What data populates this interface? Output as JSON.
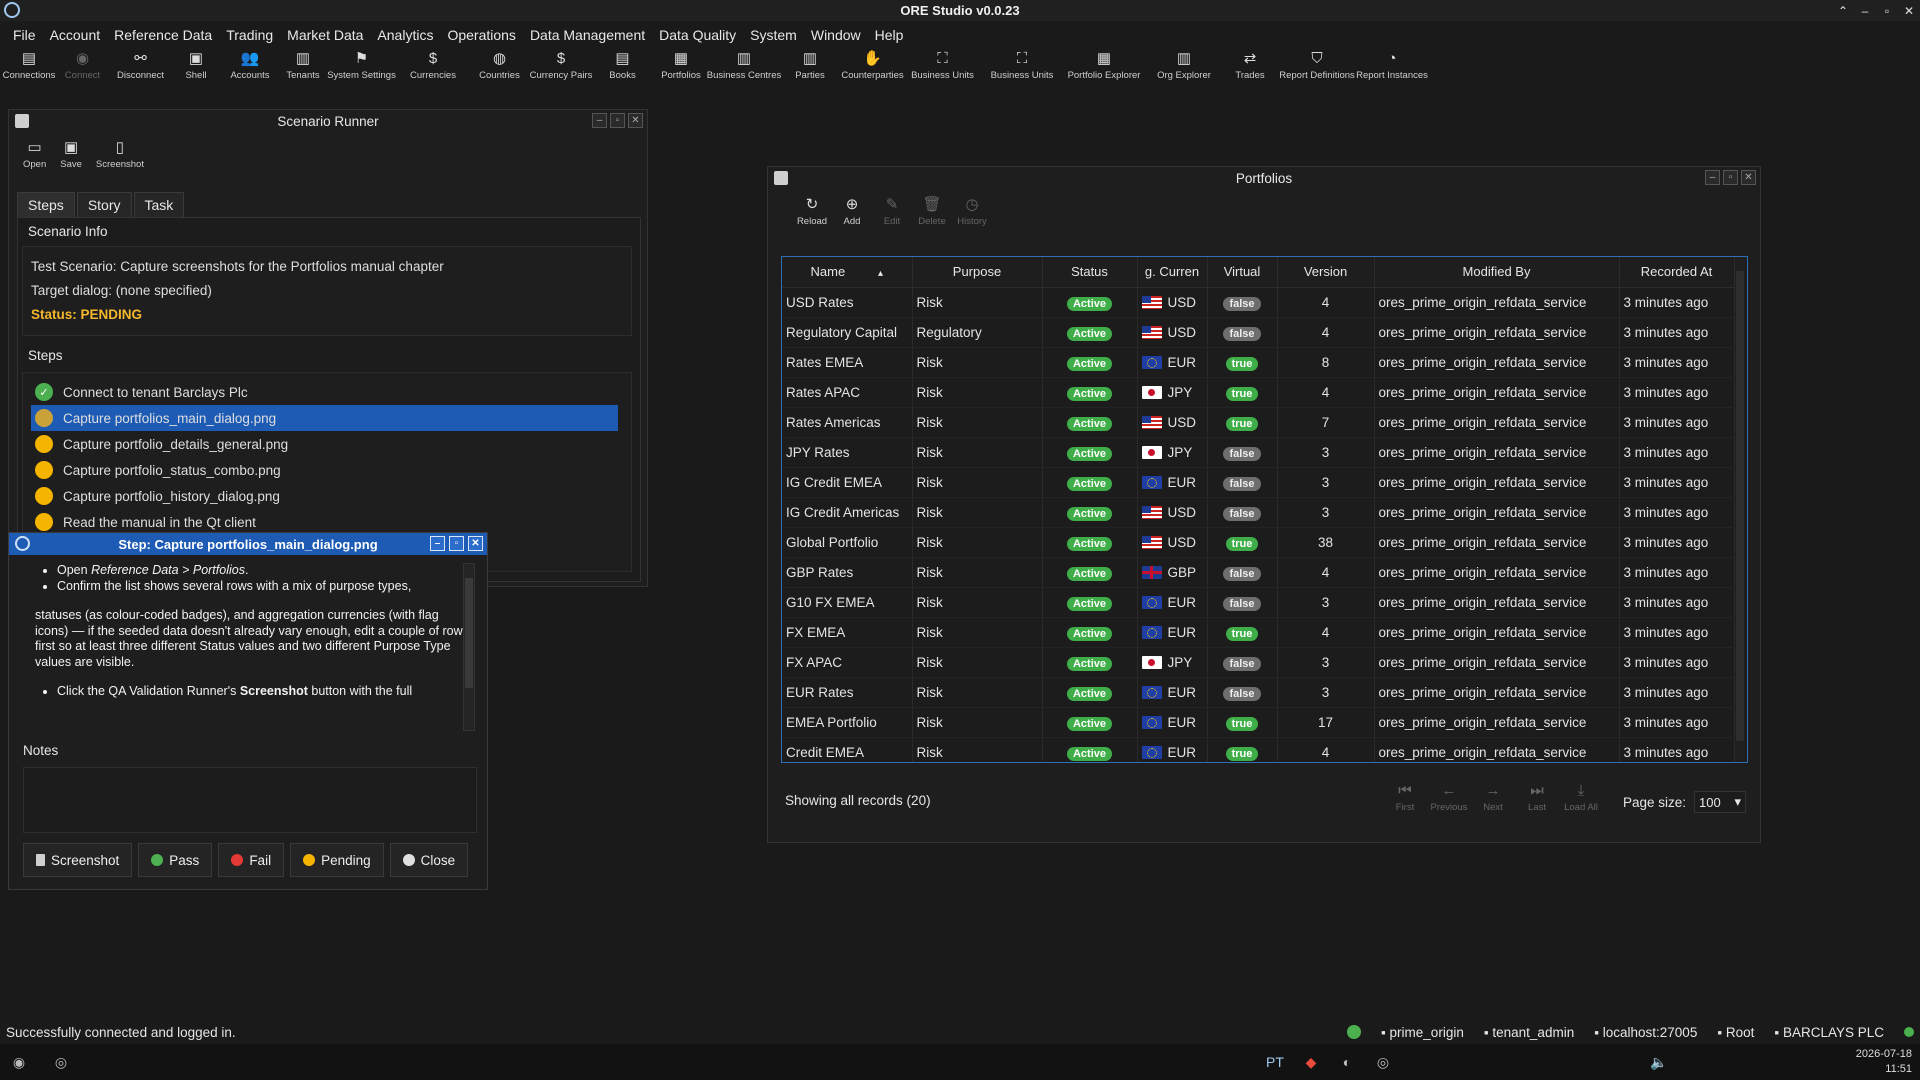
{
  "app": {
    "title": "ORE Studio v0.0.23"
  },
  "menu": [
    "File",
    "Account",
    "Reference Data",
    "Trading",
    "Market Data",
    "Analytics",
    "Operations",
    "Data Management",
    "Data Quality",
    "System",
    "Window",
    "Help"
  ],
  "toolbar": [
    {
      "label": "Connections",
      "icon": "connections-icon",
      "glyph": "▤",
      "enabled": true
    },
    {
      "label": "Connect",
      "icon": "connect-icon",
      "glyph": "◉",
      "enabled": false
    },
    {
      "label": "Disconnect",
      "icon": "disconnect-icon",
      "glyph": "⚯",
      "enabled": true
    },
    {
      "label": "Shell",
      "icon": "shell-icon",
      "glyph": "▣",
      "enabled": true
    },
    {
      "label": "Accounts",
      "icon": "accounts-icon",
      "glyph": "👥",
      "enabled": true
    },
    {
      "label": "Tenants",
      "icon": "tenants-icon",
      "glyph": "▥",
      "enabled": true
    },
    {
      "label": "System Settings",
      "icon": "flag-icon",
      "glyph": "⚑",
      "enabled": true
    },
    {
      "label": "Currencies",
      "icon": "currency-icon",
      "glyph": "$",
      "enabled": true
    },
    {
      "label": "Countries",
      "icon": "globe-icon",
      "glyph": "◍",
      "enabled": true
    },
    {
      "label": "Currency Pairs",
      "icon": "currency-pairs-icon",
      "glyph": "$",
      "enabled": true
    },
    {
      "label": "Books",
      "icon": "books-icon",
      "glyph": "▤",
      "enabled": true
    },
    {
      "label": "Portfolios",
      "icon": "briefcase-icon",
      "glyph": "▦",
      "enabled": true
    },
    {
      "label": "Business Centres",
      "icon": "building-icon",
      "glyph": "▥",
      "enabled": true
    },
    {
      "label": "Parties",
      "icon": "parties-icon",
      "glyph": "▥",
      "enabled": true
    },
    {
      "label": "Counterparties",
      "icon": "handshake-icon",
      "glyph": "✋",
      "enabled": true
    },
    {
      "label": "Business Units",
      "icon": "org-icon",
      "glyph": "⛶",
      "enabled": true
    },
    {
      "label": "Business Units",
      "icon": "org-icon",
      "glyph": "⛶",
      "enabled": true
    },
    {
      "label": "Portfolio Explorer",
      "icon": "portfolio-explorer-icon",
      "glyph": "▦",
      "enabled": true
    },
    {
      "label": "Org Explorer",
      "icon": "org-explorer-icon",
      "glyph": "▥",
      "enabled": true
    },
    {
      "label": "Trades",
      "icon": "trades-icon",
      "glyph": "⇄",
      "enabled": true
    },
    {
      "label": "Report Definitions",
      "icon": "report-definitions-icon",
      "glyph": "⛉",
      "enabled": true
    },
    {
      "label": "Report Instances",
      "icon": "report-instances-icon",
      "glyph": "◔",
      "enabled": true
    }
  ],
  "scenario": {
    "title": "Scenario Runner",
    "toolbar": [
      {
        "label": "Open",
        "icon": "open-folder-icon",
        "glyph": "▭"
      },
      {
        "label": "Save",
        "icon": "save-icon",
        "glyph": "▣"
      },
      {
        "label": "Screenshot",
        "icon": "screenshot-icon",
        "glyph": "▯"
      }
    ],
    "tabs": [
      "Steps",
      "Story",
      "Task"
    ],
    "info_label": "Scenario Info",
    "info": {
      "test_scenario": "Test Scenario: Capture screenshots for the Portfolios manual chapter",
      "target_dialog": "Target dialog: (none specified)",
      "status": "Status: PENDING"
    },
    "steps_label": "Steps",
    "steps": [
      {
        "label": "Connect to tenant Barclays Plc",
        "state": "done"
      },
      {
        "label": "Capture portfolios_main_dialog.png",
        "state": "current"
      },
      {
        "label": "Capture portfolio_details_general.png",
        "state": "pending"
      },
      {
        "label": "Capture portfolio_status_combo.png",
        "state": "pending"
      },
      {
        "label": "Capture portfolio_history_dialog.png",
        "state": "pending"
      },
      {
        "label": "Read the manual in the Qt client",
        "state": "pending"
      }
    ]
  },
  "step_dialog": {
    "title": "Step: Capture portfolios_main_dialog.png",
    "open_prefix": "Open ",
    "open_path": "Reference Data > Portfolios",
    "open_suffix": ".",
    "confirm": "Confirm the list shows several rows with a mix of purpose types,",
    "paragraph": "statuses (as colour-coded badges), and aggregation currencies (with flag icons) — if the seeded data doesn't already vary enough, edit a couple of rows first so at least three different Status values and two different Purpose Type values are visible.",
    "click_prefix": "Click the QA Validation Runner's ",
    "click_bold": "Screenshot",
    "click_suffix": " button with the full",
    "notes_label": "Notes",
    "buttons": [
      {
        "label": "Screenshot",
        "icon": "screenshot-icon",
        "color": "#cfcfcf"
      },
      {
        "label": "Pass",
        "icon": "pass-icon",
        "color": "#4caf50"
      },
      {
        "label": "Fail",
        "icon": "fail-icon",
        "color": "#e53935"
      },
      {
        "label": "Pending",
        "icon": "pending-icon",
        "color": "#f5b400"
      },
      {
        "label": "Close",
        "icon": "close-icon",
        "color": "#e0e0e0"
      }
    ]
  },
  "portfolios": {
    "title": "Portfolios",
    "toolbar": [
      {
        "label": "Reload",
        "icon": "reload-icon",
        "glyph": "↻",
        "enabled": true
      },
      {
        "label": "Add",
        "icon": "add-icon",
        "glyph": "⊕",
        "enabled": true
      },
      {
        "label": "Edit",
        "icon": "edit-icon",
        "glyph": "✎",
        "enabled": false
      },
      {
        "label": "Delete",
        "icon": "delete-icon",
        "glyph": "🗑",
        "enabled": false
      },
      {
        "label": "History",
        "icon": "history-icon",
        "glyph": "◷",
        "enabled": false
      }
    ],
    "columns": [
      "Name",
      "Purpose",
      "Status",
      "g. Curren",
      "Virtual",
      "Version",
      "Modified By",
      "Recorded At"
    ],
    "rows": [
      {
        "name": "USD Rates",
        "purpose": "Risk",
        "status": "Active",
        "ccy": "USD",
        "virtual": "false",
        "version": "4",
        "modified_by": "ores_prime_origin_refdata_service",
        "recorded_at": "3 minutes ago"
      },
      {
        "name": "Regulatory Capital",
        "purpose": "Regulatory",
        "status": "Active",
        "ccy": "USD",
        "virtual": "false",
        "version": "4",
        "modified_by": "ores_prime_origin_refdata_service",
        "recorded_at": "3 minutes ago"
      },
      {
        "name": "Rates EMEA",
        "purpose": "Risk",
        "status": "Active",
        "ccy": "EUR",
        "virtual": "true",
        "version": "8",
        "modified_by": "ores_prime_origin_refdata_service",
        "recorded_at": "3 minutes ago"
      },
      {
        "name": "Rates APAC",
        "purpose": "Risk",
        "status": "Active",
        "ccy": "JPY",
        "virtual": "true",
        "version": "4",
        "modified_by": "ores_prime_origin_refdata_service",
        "recorded_at": "3 minutes ago"
      },
      {
        "name": "Rates Americas",
        "purpose": "Risk",
        "status": "Active",
        "ccy": "USD",
        "virtual": "true",
        "version": "7",
        "modified_by": "ores_prime_origin_refdata_service",
        "recorded_at": "3 minutes ago"
      },
      {
        "name": "JPY Rates",
        "purpose": "Risk",
        "status": "Active",
        "ccy": "JPY",
        "virtual": "false",
        "version": "3",
        "modified_by": "ores_prime_origin_refdata_service",
        "recorded_at": "3 minutes ago"
      },
      {
        "name": "IG Credit EMEA",
        "purpose": "Risk",
        "status": "Active",
        "ccy": "EUR",
        "virtual": "false",
        "version": "3",
        "modified_by": "ores_prime_origin_refdata_service",
        "recorded_at": "3 minutes ago"
      },
      {
        "name": "IG Credit Americas",
        "purpose": "Risk",
        "status": "Active",
        "ccy": "USD",
        "virtual": "false",
        "version": "3",
        "modified_by": "ores_prime_origin_refdata_service",
        "recorded_at": "3 minutes ago"
      },
      {
        "name": "Global Portfolio",
        "purpose": "Risk",
        "status": "Active",
        "ccy": "USD",
        "virtual": "true",
        "version": "38",
        "modified_by": "ores_prime_origin_refdata_service",
        "recorded_at": "3 minutes ago"
      },
      {
        "name": "GBP Rates",
        "purpose": "Risk",
        "status": "Active",
        "ccy": "GBP",
        "virtual": "false",
        "version": "4",
        "modified_by": "ores_prime_origin_refdata_service",
        "recorded_at": "3 minutes ago"
      },
      {
        "name": "G10 FX EMEA",
        "purpose": "Risk",
        "status": "Active",
        "ccy": "EUR",
        "virtual": "false",
        "version": "3",
        "modified_by": "ores_prime_origin_refdata_service",
        "recorded_at": "3 minutes ago"
      },
      {
        "name": "FX EMEA",
        "purpose": "Risk",
        "status": "Active",
        "ccy": "EUR",
        "virtual": "true",
        "version": "4",
        "modified_by": "ores_prime_origin_refdata_service",
        "recorded_at": "3 minutes ago"
      },
      {
        "name": "FX APAC",
        "purpose": "Risk",
        "status": "Active",
        "ccy": "JPY",
        "virtual": "false",
        "version": "3",
        "modified_by": "ores_prime_origin_refdata_service",
        "recorded_at": "3 minutes ago"
      },
      {
        "name": "EUR Rates",
        "purpose": "Risk",
        "status": "Active",
        "ccy": "EUR",
        "virtual": "false",
        "version": "3",
        "modified_by": "ores_prime_origin_refdata_service",
        "recorded_at": "3 minutes ago"
      },
      {
        "name": "EMEA Portfolio",
        "purpose": "Risk",
        "status": "Active",
        "ccy": "EUR",
        "virtual": "true",
        "version": "17",
        "modified_by": "ores_prime_origin_refdata_service",
        "recorded_at": "3 minutes ago"
      },
      {
        "name": "Credit EMEA",
        "purpose": "Risk",
        "status": "Active",
        "ccy": "EUR",
        "virtual": "true",
        "version": "4",
        "modified_by": "ores_prime_origin_refdata_service",
        "recorded_at": "3 minutes ago"
      }
    ],
    "records_text": "Showing all records (20)",
    "pager": [
      {
        "label": "First",
        "icon": "first-page-icon",
        "glyph": "⏮"
      },
      {
        "label": "Previous",
        "icon": "previous-icon",
        "glyph": "←"
      },
      {
        "label": "Next",
        "icon": "next-icon",
        "glyph": "→"
      },
      {
        "label": "Last",
        "icon": "last-page-icon",
        "glyph": "⏭"
      },
      {
        "label": "Load All",
        "icon": "load-all-icon",
        "glyph": "⤓"
      }
    ],
    "page_size_label": "Page size:",
    "page_size": "100"
  },
  "statusbar": {
    "message": "Successfully connected and logged in.",
    "items": [
      {
        "label": "prime_origin",
        "icon": "tag-icon"
      },
      {
        "label": "tenant_admin",
        "icon": "user-icon"
      },
      {
        "label": "localhost:27005",
        "icon": "server-icon"
      },
      {
        "label": "Root",
        "icon": "building-icon"
      },
      {
        "label": "BARCLAYS PLC",
        "icon": "bank-icon"
      }
    ]
  },
  "taskbar": {
    "lang": "PT",
    "date": "2026-07-18",
    "time": "11:51"
  }
}
